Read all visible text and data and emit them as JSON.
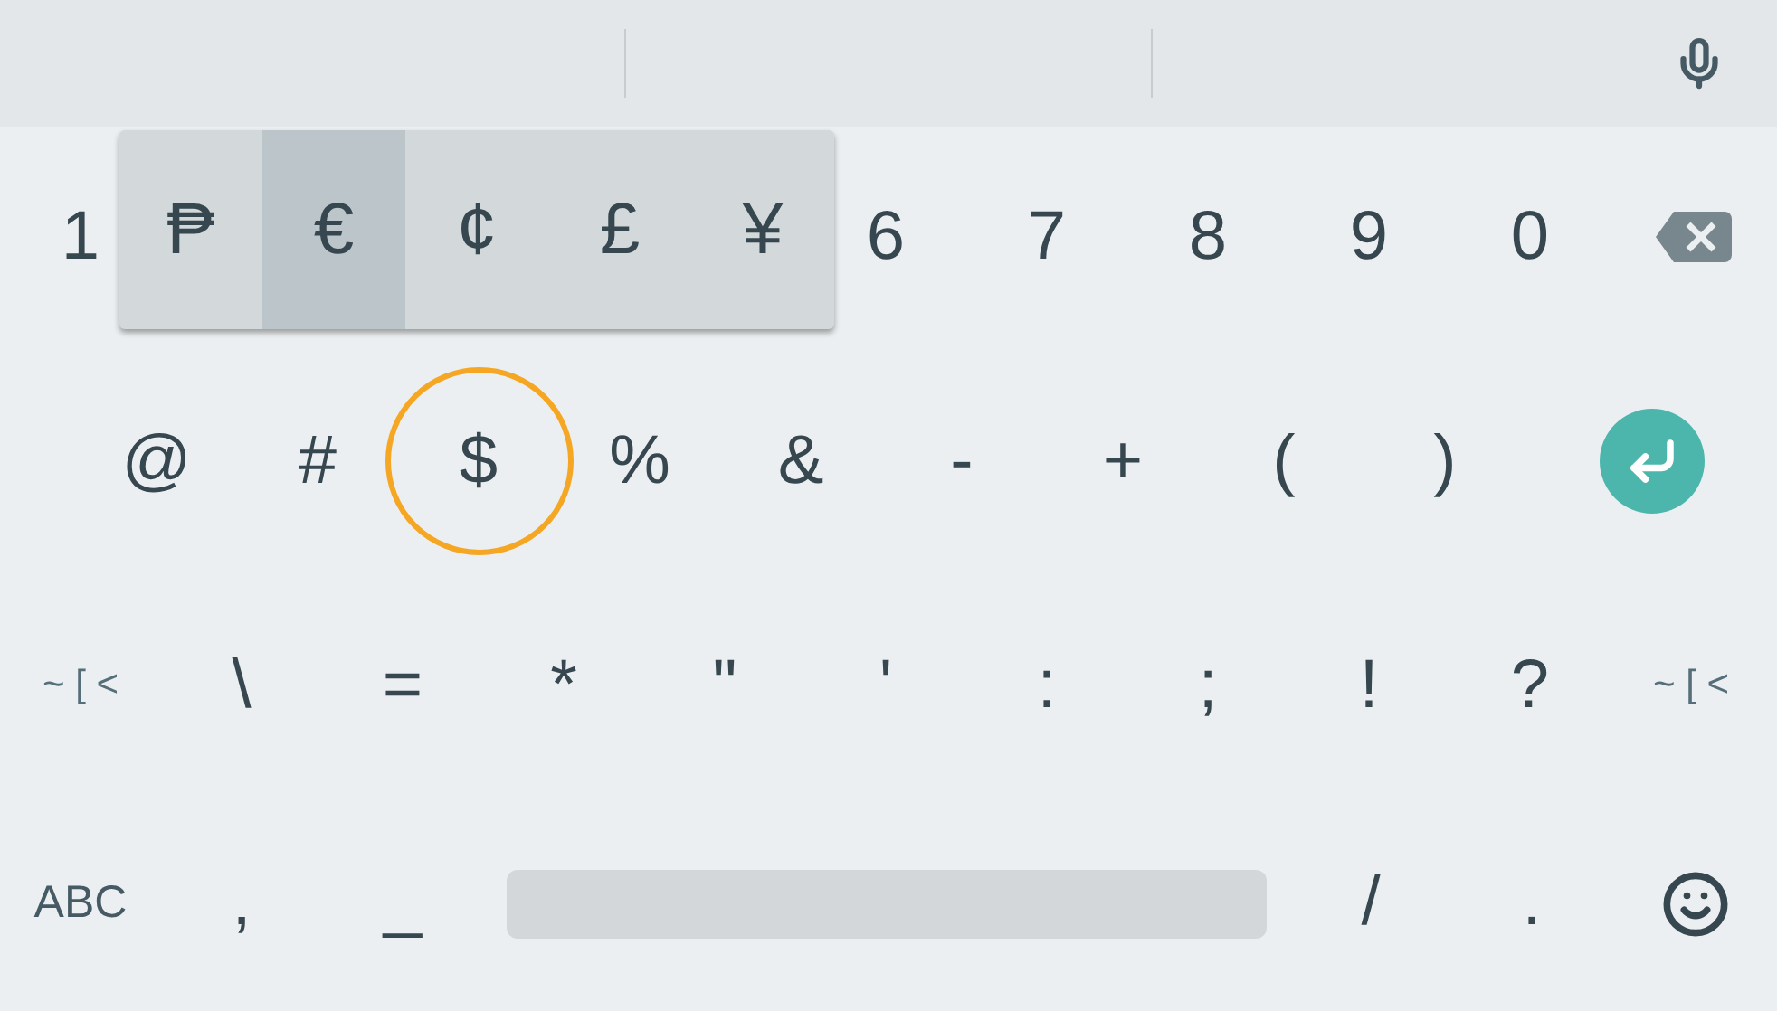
{
  "popup": {
    "keys": [
      {
        "label": "₱",
        "selected": false
      },
      {
        "label": "€",
        "selected": true
      },
      {
        "label": "¢",
        "selected": false
      },
      {
        "label": "£",
        "selected": false
      },
      {
        "label": "¥",
        "selected": false
      }
    ]
  },
  "rows": [
    {
      "keys": [
        {
          "kind": "char",
          "label": "1"
        },
        {
          "kind": "char",
          "label": "6"
        },
        {
          "kind": "char",
          "label": "7"
        },
        {
          "kind": "char",
          "label": "8"
        },
        {
          "kind": "char",
          "label": "9"
        },
        {
          "kind": "char",
          "label": "0"
        },
        {
          "kind": "backspace"
        }
      ]
    },
    {
      "keys": [
        {
          "kind": "char",
          "label": "@"
        },
        {
          "kind": "char",
          "label": "#"
        },
        {
          "kind": "char",
          "label": "$",
          "highlighted": true
        },
        {
          "kind": "char",
          "label": "%"
        },
        {
          "kind": "char",
          "label": "&"
        },
        {
          "kind": "char",
          "label": "-"
        },
        {
          "kind": "char",
          "label": "+"
        },
        {
          "kind": "char",
          "label": "("
        },
        {
          "kind": "char",
          "label": ")"
        },
        {
          "kind": "enter"
        }
      ]
    },
    {
      "keys": [
        {
          "kind": "mode",
          "label": "~ [ <"
        },
        {
          "kind": "char",
          "label": "\\"
        },
        {
          "kind": "char",
          "label": "="
        },
        {
          "kind": "char",
          "label": "*"
        },
        {
          "kind": "char",
          "label": "\""
        },
        {
          "kind": "char",
          "label": "'"
        },
        {
          "kind": "char",
          "label": ":"
        },
        {
          "kind": "char",
          "label": ";"
        },
        {
          "kind": "char",
          "label": "!"
        },
        {
          "kind": "char",
          "label": "?"
        },
        {
          "kind": "mode",
          "label": "~ [ <"
        }
      ]
    },
    {
      "keys": [
        {
          "kind": "abc",
          "label": "ABC"
        },
        {
          "kind": "char",
          "label": ","
        },
        {
          "kind": "char",
          "label": "_"
        },
        {
          "kind": "space"
        },
        {
          "kind": "char",
          "label": "/"
        },
        {
          "kind": "char",
          "label": "."
        },
        {
          "kind": "emoji"
        }
      ]
    }
  ]
}
